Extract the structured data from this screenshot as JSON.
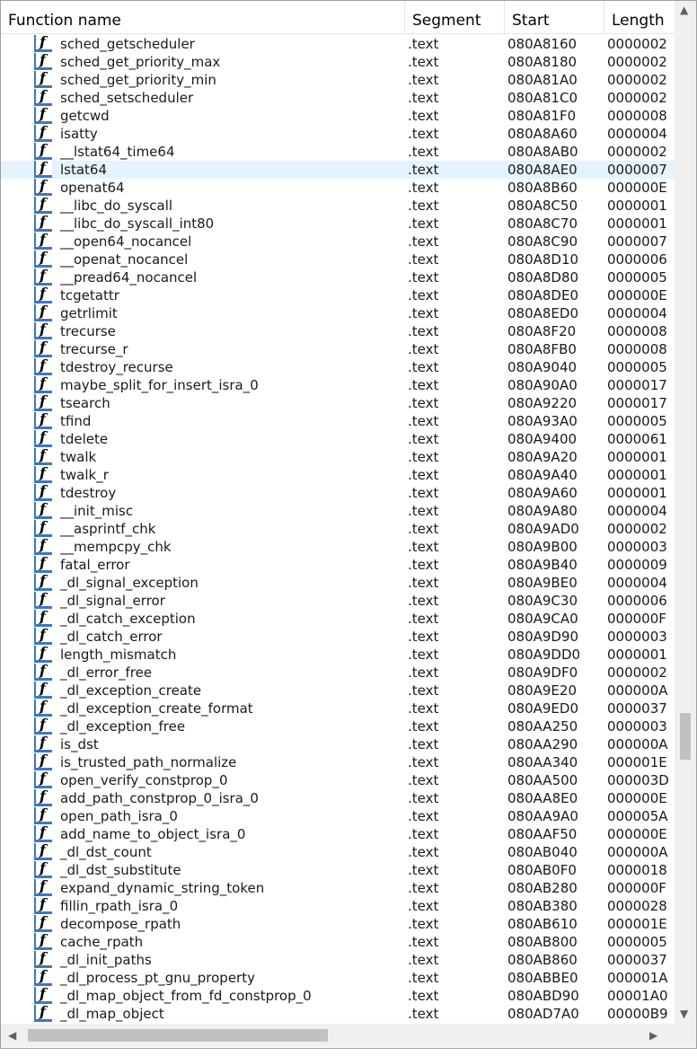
{
  "columns": {
    "name": "Function name",
    "segment": "Segment",
    "start": "Start",
    "length": "Length"
  },
  "icon": "function-icon",
  "icon_glyph": "f",
  "selected_index": 7,
  "colors": {
    "selected_row": "#e5f3ff",
    "icon_border": "#3a77c9"
  },
  "rows": [
    {
      "name": "sched_getscheduler",
      "segment": ".text",
      "start": "080A8160",
      "length": "0000002"
    },
    {
      "name": "sched_get_priority_max",
      "segment": ".text",
      "start": "080A8180",
      "length": "0000002"
    },
    {
      "name": "sched_get_priority_min",
      "segment": ".text",
      "start": "080A81A0",
      "length": "0000002"
    },
    {
      "name": "sched_setscheduler",
      "segment": ".text",
      "start": "080A81C0",
      "length": "0000002"
    },
    {
      "name": "getcwd",
      "segment": ".text",
      "start": "080A81F0",
      "length": "0000008"
    },
    {
      "name": "isatty",
      "segment": ".text",
      "start": "080A8A60",
      "length": "0000004"
    },
    {
      "name": "__lstat64_time64",
      "segment": ".text",
      "start": "080A8AB0",
      "length": "0000002"
    },
    {
      "name": "lstat64",
      "segment": ".text",
      "start": "080A8AE0",
      "length": "0000007"
    },
    {
      "name": "openat64",
      "segment": ".text",
      "start": "080A8B60",
      "length": "000000E"
    },
    {
      "name": "__libc_do_syscall",
      "segment": ".text",
      "start": "080A8C50",
      "length": "0000001"
    },
    {
      "name": "__libc_do_syscall_int80",
      "segment": ".text",
      "start": "080A8C70",
      "length": "0000001"
    },
    {
      "name": "__open64_nocancel",
      "segment": ".text",
      "start": "080A8C90",
      "length": "0000007"
    },
    {
      "name": "__openat_nocancel",
      "segment": ".text",
      "start": "080A8D10",
      "length": "0000006"
    },
    {
      "name": "__pread64_nocancel",
      "segment": ".text",
      "start": "080A8D80",
      "length": "0000005"
    },
    {
      "name": "tcgetattr",
      "segment": ".text",
      "start": "080A8DE0",
      "length": "000000E"
    },
    {
      "name": "getrlimit",
      "segment": ".text",
      "start": "080A8ED0",
      "length": "0000004"
    },
    {
      "name": "trecurse",
      "segment": ".text",
      "start": "080A8F20",
      "length": "0000008"
    },
    {
      "name": "trecurse_r",
      "segment": ".text",
      "start": "080A8FB0",
      "length": "0000008"
    },
    {
      "name": "tdestroy_recurse",
      "segment": ".text",
      "start": "080A9040",
      "length": "0000005"
    },
    {
      "name": "maybe_split_for_insert_isra_0",
      "segment": ".text",
      "start": "080A90A0",
      "length": "0000017"
    },
    {
      "name": "tsearch",
      "segment": ".text",
      "start": "080A9220",
      "length": "0000017"
    },
    {
      "name": "tfind",
      "segment": ".text",
      "start": "080A93A0",
      "length": "0000005"
    },
    {
      "name": "tdelete",
      "segment": ".text",
      "start": "080A9400",
      "length": "0000061"
    },
    {
      "name": "twalk",
      "segment": ".text",
      "start": "080A9A20",
      "length": "0000001"
    },
    {
      "name": "twalk_r",
      "segment": ".text",
      "start": "080A9A40",
      "length": "0000001"
    },
    {
      "name": "tdestroy",
      "segment": ".text",
      "start": "080A9A60",
      "length": "0000001"
    },
    {
      "name": "__init_misc",
      "segment": ".text",
      "start": "080A9A80",
      "length": "0000004"
    },
    {
      "name": "__asprintf_chk",
      "segment": ".text",
      "start": "080A9AD0",
      "length": "0000002"
    },
    {
      "name": "__mempcpy_chk",
      "segment": ".text",
      "start": "080A9B00",
      "length": "0000003"
    },
    {
      "name": "fatal_error",
      "segment": ".text",
      "start": "080A9B40",
      "length": "0000009"
    },
    {
      "name": "_dl_signal_exception",
      "segment": ".text",
      "start": "080A9BE0",
      "length": "0000004"
    },
    {
      "name": "_dl_signal_error",
      "segment": ".text",
      "start": "080A9C30",
      "length": "0000006"
    },
    {
      "name": "_dl_catch_exception",
      "segment": ".text",
      "start": "080A9CA0",
      "length": "000000F"
    },
    {
      "name": "_dl_catch_error",
      "segment": ".text",
      "start": "080A9D90",
      "length": "0000003"
    },
    {
      "name": "length_mismatch",
      "segment": ".text",
      "start": "080A9DD0",
      "length": "0000001"
    },
    {
      "name": "_dl_error_free",
      "segment": ".text",
      "start": "080A9DF0",
      "length": "0000002"
    },
    {
      "name": "_dl_exception_create",
      "segment": ".text",
      "start": "080A9E20",
      "length": "000000A"
    },
    {
      "name": "_dl_exception_create_format",
      "segment": ".text",
      "start": "080A9ED0",
      "length": "0000037"
    },
    {
      "name": "_dl_exception_free",
      "segment": ".text",
      "start": "080AA250",
      "length": "0000003"
    },
    {
      "name": "is_dst",
      "segment": ".text",
      "start": "080AA290",
      "length": "000000A"
    },
    {
      "name": "is_trusted_path_normalize",
      "segment": ".text",
      "start": "080AA340",
      "length": "000001E"
    },
    {
      "name": "open_verify_constprop_0",
      "segment": ".text",
      "start": "080AA500",
      "length": "000003D"
    },
    {
      "name": "add_path_constprop_0_isra_0",
      "segment": ".text",
      "start": "080AA8E0",
      "length": "000000E"
    },
    {
      "name": "open_path_isra_0",
      "segment": ".text",
      "start": "080AA9A0",
      "length": "000005A"
    },
    {
      "name": "add_name_to_object_isra_0",
      "segment": ".text",
      "start": "080AAF50",
      "length": "000000E"
    },
    {
      "name": "_dl_dst_count",
      "segment": ".text",
      "start": "080AB040",
      "length": "000000A"
    },
    {
      "name": "_dl_dst_substitute",
      "segment": ".text",
      "start": "080AB0F0",
      "length": "0000018"
    },
    {
      "name": "expand_dynamic_string_token",
      "segment": ".text",
      "start": "080AB280",
      "length": "000000F"
    },
    {
      "name": "fillin_rpath_isra_0",
      "segment": ".text",
      "start": "080AB380",
      "length": "0000028"
    },
    {
      "name": "decompose_rpath",
      "segment": ".text",
      "start": "080AB610",
      "length": "000001E"
    },
    {
      "name": "cache_rpath",
      "segment": ".text",
      "start": "080AB800",
      "length": "0000005"
    },
    {
      "name": "_dl_init_paths",
      "segment": ".text",
      "start": "080AB860",
      "length": "0000037"
    },
    {
      "name": "_dl_process_pt_gnu_property",
      "segment": ".text",
      "start": "080ABBE0",
      "length": "000001A"
    },
    {
      "name": "_dl_map_object_from_fd_constprop_0",
      "segment": ".text",
      "start": "080ABD90",
      "length": "00001A0"
    },
    {
      "name": "_dl_map_object",
      "segment": ".text",
      "start": "080AD7A0",
      "length": "00000B9"
    }
  ],
  "scrollbar": {
    "up_arrow": "▲",
    "down_arrow": "▼",
    "left_arrow": "◀",
    "right_arrow": "▶"
  }
}
